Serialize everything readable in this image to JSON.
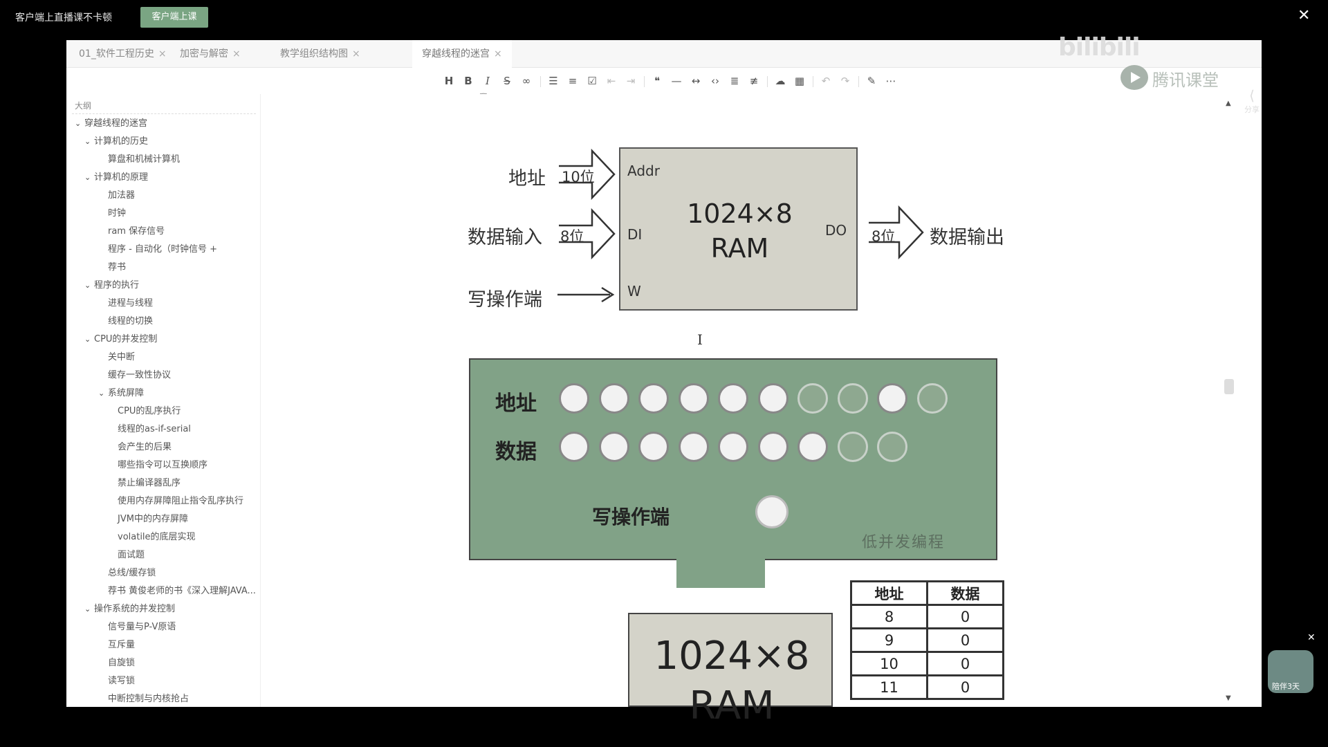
{
  "live": {
    "title": "客户端上直播课不卡顿",
    "button": "客户端上课",
    "close": "✕"
  },
  "watermark": {
    "site": "bilibili",
    "brand": "腾讯课堂"
  },
  "tabs": [
    {
      "label": "01_软件工程历史"
    },
    {
      "label": "加密与解密"
    },
    {
      "label": "教学组织结构图"
    },
    {
      "label": "穿越线程的迷宫"
    }
  ],
  "sidebar": {
    "title": "大纲",
    "items": [
      {
        "label": "穿越线程的迷宫",
        "level": 0,
        "expanded": true
      },
      {
        "label": "计算机的历史",
        "level": 1,
        "expanded": true
      },
      {
        "label": "算盘和机械计算机",
        "level": 2
      },
      {
        "label": "计算机的原理",
        "level": 1,
        "expanded": true
      },
      {
        "label": "加法器",
        "level": 2
      },
      {
        "label": "时钟",
        "level": 2
      },
      {
        "label": "ram 保存信号",
        "level": 2
      },
      {
        "label": "程序 - 自动化（时钟信号 +",
        "level": 2
      },
      {
        "label": "荐书",
        "level": 2
      },
      {
        "label": "程序的执行",
        "level": 1,
        "expanded": true
      },
      {
        "label": "进程与线程",
        "level": 2
      },
      {
        "label": "线程的切换",
        "level": 2
      },
      {
        "label": "CPU的并发控制",
        "level": 1,
        "expanded": true
      },
      {
        "label": "关中断",
        "level": 2
      },
      {
        "label": "缓存一致性协议",
        "level": 2
      },
      {
        "label": "系统屏障",
        "level": 2,
        "expanded": true
      },
      {
        "label": "CPU的乱序执行",
        "level": 3
      },
      {
        "label": "线程的as-if-serial",
        "level": 3
      },
      {
        "label": "会产生的后果",
        "level": 3
      },
      {
        "label": "哪些指令可以互换顺序",
        "level": 3
      },
      {
        "label": "禁止编译器乱序",
        "level": 3
      },
      {
        "label": "使用内存屏障阻止指令乱序执行",
        "level": 3
      },
      {
        "label": "JVM中的内存屏障",
        "level": 3
      },
      {
        "label": "volatile的底层实现",
        "level": 3
      },
      {
        "label": "面试题",
        "level": 3
      },
      {
        "label": "总线/缓存锁",
        "level": 2
      },
      {
        "label": "荐书 黄俊老师的书《深入理解JAVA...",
        "level": 2
      },
      {
        "label": "操作系统的并发控制",
        "level": 1,
        "expanded": true
      },
      {
        "label": "信号量与P-V原语",
        "level": 2
      },
      {
        "label": "互斥量",
        "level": 2
      },
      {
        "label": "自旋锁",
        "level": 2
      },
      {
        "label": "读写锁",
        "level": 2
      },
      {
        "label": "中断控制与内核抢占",
        "level": 2
      }
    ]
  },
  "toolbar": {
    "heading": "H",
    "bold": "B",
    "italic": "I",
    "strike": "S̶",
    "link": "🔗"
  },
  "share": {
    "label": "分享"
  },
  "diagram1": {
    "addr_label": "地址",
    "addr_bits": "10位",
    "data_in_label": "数据输入",
    "data_in_bits": "8位",
    "write_label": "写操作端",
    "port_addr": "Addr",
    "port_di": "DI",
    "port_do": "DO",
    "port_w": "W",
    "ram_size": "1024×8",
    "ram_name": "RAM",
    "out_bits": "8位",
    "data_out_label": "数据输出"
  },
  "diagram2": {
    "addr_label": "地址",
    "data_label": "数据",
    "write_label": "写操作端",
    "watermark": "低并发编程",
    "addr_leds": [
      1,
      1,
      1,
      1,
      1,
      1,
      0,
      0,
      1,
      0
    ],
    "data_leds": [
      1,
      1,
      1,
      1,
      1,
      1,
      1,
      0,
      0
    ]
  },
  "diagram3": {
    "ram_size": "1024×8",
    "ram_name": "RAM"
  },
  "table": {
    "headers": [
      "地址",
      "数据"
    ],
    "rows": [
      [
        "8",
        "0"
      ],
      [
        "9",
        "0"
      ],
      [
        "10",
        "0"
      ],
      [
        "11",
        "0"
      ]
    ]
  },
  "pip": {
    "label": "陪伴3天"
  }
}
